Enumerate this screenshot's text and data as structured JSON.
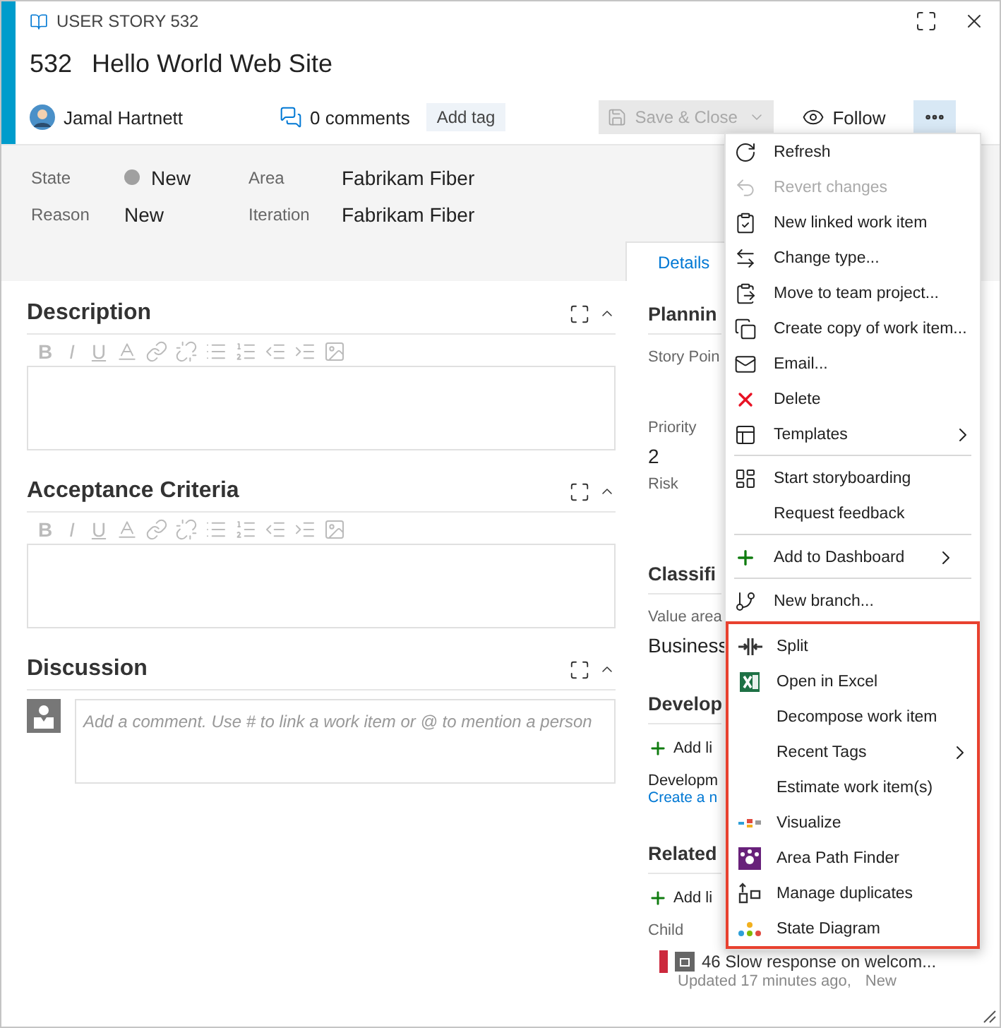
{
  "work_item": {
    "type_label": "USER STORY 532",
    "id": "532",
    "title": "Hello World Web Site"
  },
  "meta": {
    "assignee": "Jamal Hartnett",
    "comments": "0 comments",
    "add_tag": "Add tag",
    "save_button": {
      "label": "Save & Close",
      "disabled": true
    },
    "follow_button": "Follow",
    "more_button": {
      "expanded": true
    }
  },
  "fields": [
    {
      "label": "State",
      "value": "New",
      "color": "#a0a0a0"
    },
    {
      "label": "Area",
      "value": "Fabrikam Fiber"
    },
    {
      "label": "Reason",
      "value": "New"
    },
    {
      "label": "Iteration",
      "value": "Fabrikam Fiber"
    }
  ],
  "tabs": [
    {
      "label": "Details",
      "selected": true
    }
  ],
  "left_sections": [
    {
      "title": "Description",
      "kind": "editor",
      "format_buttons": [
        "B",
        "I",
        "U"
      ]
    },
    {
      "title": "Acceptance Criteria",
      "kind": "editor",
      "format_buttons": [
        "B",
        "I",
        "U"
      ]
    },
    {
      "title": "Discussion",
      "kind": "comment",
      "placeholder": "Add a comment. Use # to link a work item or @ to mention a person"
    }
  ],
  "right_column": {
    "planning": {
      "heading": "Plannin",
      "story_points": "Story Poin",
      "priority_label": "Priority",
      "priority_value": "2",
      "risk_label": "Risk"
    },
    "classification": {
      "heading": "Classifi",
      "value_area_label": "Value area",
      "value_area": "Business"
    },
    "development": {
      "heading": "Develop",
      "add_link": "Add li",
      "label": "Developm",
      "create_link": "Create a n"
    },
    "related": {
      "heading": "Related",
      "add_link": "Add li",
      "group": "Child",
      "child": {
        "title": "46 Slow response on welcom...",
        "updated": "Updated 17 minutes ago,",
        "state": "New",
        "color": "#cc293d"
      }
    }
  },
  "menu": {
    "sections": [
      {
        "highlighted": false,
        "items": [
          {
            "label": "Refresh",
            "disabled": false,
            "submenu": false
          },
          {
            "label": "Revert changes",
            "disabled": true,
            "submenu": false
          },
          {
            "label": "New linked work item",
            "disabled": false,
            "submenu": false
          },
          {
            "label": "Change type...",
            "disabled": false,
            "submenu": false
          },
          {
            "label": "Move to team project...",
            "disabled": false,
            "submenu": false
          },
          {
            "label": "Create copy of work item...",
            "disabled": false,
            "submenu": false
          },
          {
            "label": "Email...",
            "disabled": false,
            "submenu": false
          },
          {
            "label": "Delete",
            "disabled": false,
            "submenu": false
          },
          {
            "label": "Templates",
            "disabled": false,
            "submenu": true
          }
        ]
      },
      {
        "highlighted": false,
        "items": [
          {
            "label": "Start storyboarding",
            "disabled": false,
            "submenu": false
          },
          {
            "label": "Request feedback",
            "disabled": false,
            "submenu": false
          }
        ]
      },
      {
        "highlighted": false,
        "items": [
          {
            "label": "Add to Dashboard",
            "disabled": false,
            "submenu": true
          }
        ]
      },
      {
        "highlighted": false,
        "items": [
          {
            "label": "New branch...",
            "disabled": false,
            "submenu": false
          }
        ]
      },
      {
        "highlighted": true,
        "items": [
          {
            "label": "Split",
            "disabled": false,
            "submenu": false
          },
          {
            "label": "Open in Excel",
            "disabled": false,
            "submenu": false
          },
          {
            "label": "Decompose work item",
            "disabled": false,
            "submenu": false
          },
          {
            "label": "Recent Tags",
            "disabled": false,
            "submenu": true
          },
          {
            "label": "Estimate work item(s)",
            "disabled": false,
            "submenu": false
          },
          {
            "label": "Visualize",
            "disabled": false,
            "submenu": false
          },
          {
            "label": "Area Path Finder",
            "disabled": false,
            "submenu": false
          },
          {
            "label": "Manage duplicates",
            "disabled": false,
            "submenu": false
          },
          {
            "label": "State Diagram",
            "disabled": false,
            "submenu": false
          }
        ]
      }
    ]
  }
}
